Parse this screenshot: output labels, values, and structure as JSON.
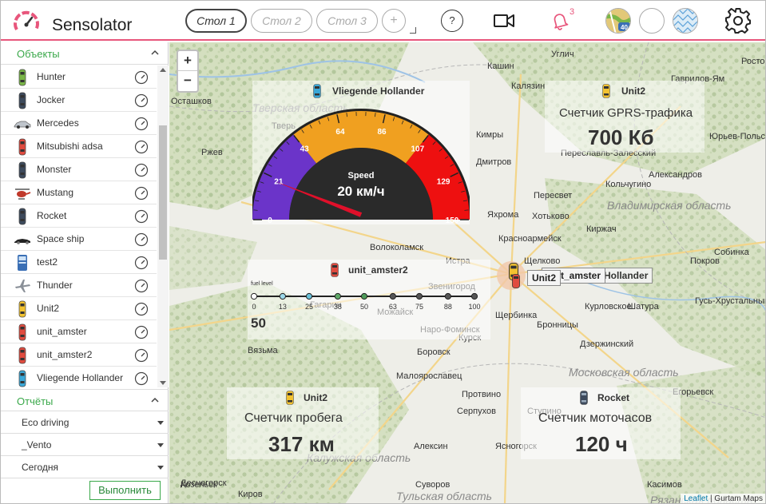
{
  "header": {
    "app_name": "Sensolator",
    "tabs": [
      {
        "label": "Стол 1",
        "active": true
      },
      {
        "label": "Стол 2",
        "active": false
      },
      {
        "label": "Стол 3",
        "active": false
      }
    ],
    "add_tab_label": "+",
    "help_label": "?",
    "notification_count": "3",
    "accent_color": "#e8567c"
  },
  "sidebar": {
    "objects_title": "Объекты",
    "objects": [
      {
        "name": "Hunter",
        "icon": "car-green-icon",
        "color": "#7ab648"
      },
      {
        "name": "Jocker",
        "icon": "car-dark-icon",
        "color": "#3d4a5c"
      },
      {
        "name": "Mercedes",
        "icon": "sedan-silver-icon",
        "color": "#bfc5cc"
      },
      {
        "name": "Mitsubishi adsa",
        "icon": "car-red-icon",
        "color": "#e04b3f"
      },
      {
        "name": "Monster",
        "icon": "car-dark-icon",
        "color": "#3d4a5c"
      },
      {
        "name": "Mustang",
        "icon": "helicopter-icon",
        "color": "#c0392b"
      },
      {
        "name": "Rocket",
        "icon": "car-dark-icon",
        "color": "#3d4a5c"
      },
      {
        "name": "Space ship",
        "icon": "sports-car-black-icon",
        "color": "#222222"
      },
      {
        "name": "test2",
        "icon": "bus-blue-icon",
        "color": "#3a6fb5"
      },
      {
        "name": "Thunder",
        "icon": "airplane-icon",
        "color": "#8a9098"
      },
      {
        "name": "Unit2",
        "icon": "car-yellow-icon",
        "color": "#f2c230"
      },
      {
        "name": "unit_amster",
        "icon": "car-red-icon",
        "color": "#e04b3f"
      },
      {
        "name": "unit_amster2",
        "icon": "car-red-icon",
        "color": "#e04b3f"
      },
      {
        "name": "Vliegende Hollander",
        "icon": "car-cyan-icon",
        "color": "#3aa8d8"
      }
    ],
    "reports_title": "Отчёты",
    "report_selects": [
      "Eco driving",
      "_Vento",
      "Сегодня"
    ],
    "run_button": "Выполнить"
  },
  "map": {
    "zoom_in": "+",
    "zoom_out": "−",
    "towns": [
      "Осташков",
      "Тверь",
      "Кашин",
      "Углич",
      "Калязин",
      "Гаврилов-Ям",
      "Ростов",
      "Ржев",
      "Кимры",
      "Дмитров",
      "Переславль-Залесский",
      "Пересвет",
      "Юрьев-Польский",
      "Александров",
      "Яхрома",
      "Хотьково",
      "Киржач",
      "Красноармейск",
      "Волоколамск",
      "Можайск",
      "Наро-Фоминск",
      "Звенигород",
      "Истра",
      "Щелково",
      "Покров",
      "Собинка",
      "Вязьма",
      "Боровск",
      "Гагарин",
      "Малоярославец",
      "Кольчугино",
      "Шатура",
      "Гусь-Хрустальный",
      "Протвино",
      "Курск",
      "Бронницы",
      "Ступино",
      "Серпухов",
      "Дзержинский",
      "Щербинка",
      "Курловское",
      "Ясногорск",
      "Киров",
      "Козельск",
      "Суворов",
      "Алексин",
      "Егорьевск",
      "Десногорск",
      "Касимов"
    ],
    "regions": [
      "Тверская область",
      "Владимирская область",
      "Московская область",
      "Калужская область",
      "Рязанская область",
      "Тульская область"
    ],
    "tooltips": [
      "Unit2",
      "unit_amster",
      "Vliegende Hollander"
    ],
    "attribution_link": "Leaflet",
    "attribution_text": " | Gurtam Maps"
  },
  "widgets": {
    "speed": {
      "object": "Vliegende Hollander",
      "label": "Speed",
      "value_text": "20 км/ч",
      "value": 20,
      "max": 150,
      "ticks": [
        "0",
        "21",
        "43",
        "64",
        "86",
        "107",
        "129",
        "150"
      ],
      "zone_colors": [
        "#6b34c9",
        "#f0a020",
        "#ee1010"
      ]
    },
    "fuel": {
      "object": "unit_amster2",
      "label": "fuel level",
      "value_text": "50",
      "value": 50,
      "ticks": [
        "0",
        "13",
        "25",
        "38",
        "50",
        "63",
        "75",
        "88",
        "100"
      ]
    },
    "gprs": {
      "object": "Unit2",
      "label": "Счетчик GPRS-трафика",
      "value_text": "700 Кб"
    },
    "mileage": {
      "object": "Unit2",
      "label": "Счетчик пробега",
      "value_text": "317 км"
    },
    "engine_hours": {
      "object": "Rocket",
      "label": "Счетчик моточасов",
      "value_text": "120 ч"
    }
  }
}
